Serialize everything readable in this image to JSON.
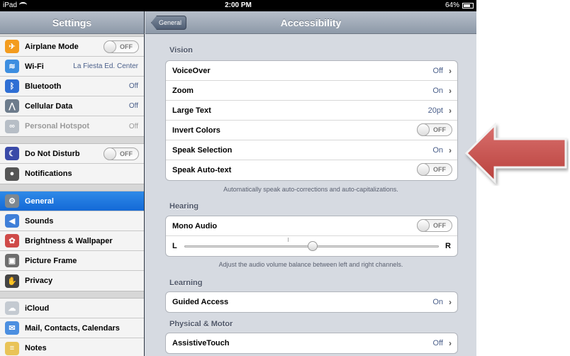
{
  "status_bar": {
    "device": "iPad",
    "time": "2:00 PM",
    "battery": "64%"
  },
  "master": {
    "title": "Settings",
    "groups": [
      [
        {
          "label": "Airplane Mode",
          "icon": "airplane-icon",
          "color": "#f39c1f",
          "glyph": "✈",
          "toggle": "OFF"
        },
        {
          "label": "Wi-Fi",
          "icon": "wifi-icon",
          "color": "#3d8ee0",
          "glyph": "≋",
          "value": "La Fiesta Ed. Center"
        },
        {
          "label": "Bluetooth",
          "icon": "bluetooth-icon",
          "color": "#2f6fd4",
          "glyph": "ᛒ",
          "value": "Off"
        },
        {
          "label": "Cellular Data",
          "icon": "antenna-icon",
          "color": "#6d7c8c",
          "glyph": "⋀",
          "value": "Off"
        },
        {
          "label": "Personal Hotspot",
          "icon": "hotspot-icon",
          "color": "#b7bec6",
          "glyph": "∞",
          "value": "Off",
          "dim": true
        }
      ],
      [
        {
          "label": "Do Not Disturb",
          "icon": "moon-icon",
          "color": "#3a4aa8",
          "glyph": "☾",
          "toggle": "OFF"
        },
        {
          "label": "Notifications",
          "icon": "notifications-icon",
          "color": "#555555",
          "glyph": "●"
        }
      ],
      [
        {
          "label": "General",
          "icon": "gear-icon",
          "color": "#7d8790",
          "glyph": "⚙",
          "selected": true
        },
        {
          "label": "Sounds",
          "icon": "speaker-icon",
          "color": "#3f7fd8",
          "glyph": "◀"
        },
        {
          "label": "Brightness & Wallpaper",
          "icon": "flower-icon",
          "color": "#cf4a48",
          "glyph": "✿"
        },
        {
          "label": "Picture Frame",
          "icon": "picture-frame-icon",
          "color": "#6e6e6e",
          "glyph": "▣"
        },
        {
          "label": "Privacy",
          "icon": "hand-icon",
          "color": "#444444",
          "glyph": "✋"
        }
      ],
      [
        {
          "label": "iCloud",
          "icon": "cloud-icon",
          "color": "#c4cad1",
          "glyph": "☁"
        },
        {
          "label": "Mail, Contacts, Calendars",
          "icon": "mail-icon",
          "color": "#4c8fe0",
          "glyph": "✉"
        },
        {
          "label": "Notes",
          "icon": "notes-icon",
          "color": "#e9c357",
          "glyph": "≡"
        }
      ]
    ]
  },
  "detail": {
    "back_label": "General",
    "title": "Accessibility",
    "sections": {
      "vision": "Vision",
      "hearing": "Hearing",
      "learning": "Learning",
      "physical": "Physical & Motor"
    },
    "vision_rows": [
      {
        "label": "VoiceOver",
        "value": "Off"
      },
      {
        "label": "Zoom",
        "value": "On"
      },
      {
        "label": "Large Text",
        "value": "20pt"
      },
      {
        "label": "Invert Colors",
        "toggle": "OFF"
      },
      {
        "label": "Speak Selection",
        "value": "On"
      },
      {
        "label": "Speak Auto-text",
        "toggle": "OFF"
      }
    ],
    "vision_footnote": "Automatically speak auto-corrections and auto-capitalizations.",
    "mono_audio": {
      "label": "Mono Audio",
      "toggle": "OFF"
    },
    "balance": {
      "left": "L",
      "right": "R",
      "level": 0.5
    },
    "hearing_footnote": "Adjust the audio volume balance between left and right channels.",
    "guided_access": {
      "label": "Guided Access",
      "value": "On"
    },
    "assistive_touch": {
      "label": "AssistiveTouch",
      "value": "Off"
    }
  },
  "annotation": {
    "color": "#c0504d"
  }
}
